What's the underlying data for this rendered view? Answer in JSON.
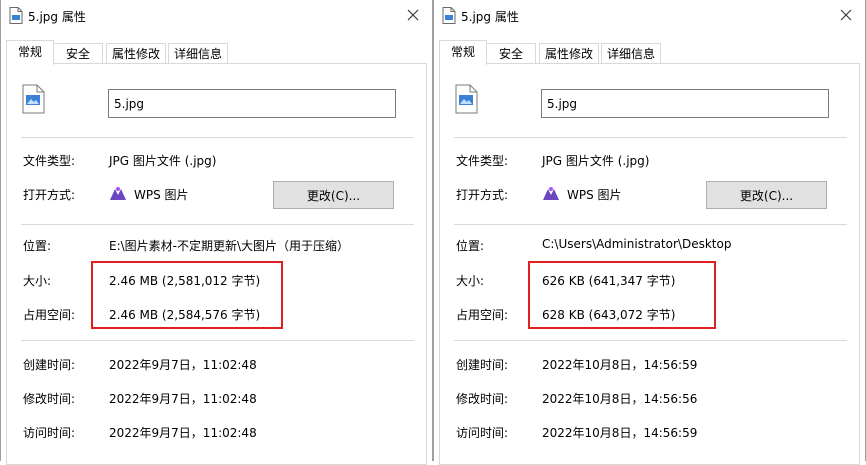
{
  "dialogs": [
    {
      "title": "5.jpg 属性",
      "tabs": [
        "常规",
        "安全",
        "属性修改",
        "详细信息"
      ],
      "filename": "5.jpg",
      "labels": {
        "type": "文件类型:",
        "open_with": "打开方式:",
        "location": "位置:",
        "size": "大小:",
        "size_on_disk": "占用空间:",
        "created": "创建时间:",
        "modified": "修改时间:",
        "accessed": "访问时间:"
      },
      "file_type": "JPG 图片文件 (.jpg)",
      "open_with_app": "WPS 图片",
      "change_button": "更改(C)...",
      "location": "E:\\图片素材-不定期更新\\大图片（用于压缩）",
      "size": "2.46 MB (2,581,012 字节)",
      "size_on_disk": "2.46 MB (2,584,576 字节)",
      "created": "2022年9月7日，11:02:48",
      "modified": "2022年9月7日，11:02:48",
      "accessed": "2022年9月7日，11:02:48"
    },
    {
      "title": "5.jpg 属性",
      "tabs": [
        "常规",
        "安全",
        "属性修改",
        "详细信息"
      ],
      "filename": "5.jpg",
      "labels": {
        "type": "文件类型:",
        "open_with": "打开方式:",
        "location": "位置:",
        "size": "大小:",
        "size_on_disk": "占用空间:",
        "created": "创建时间:",
        "modified": "修改时间:",
        "accessed": "访问时间:"
      },
      "file_type": "JPG 图片文件 (.jpg)",
      "open_with_app": "WPS 图片",
      "change_button": "更改(C)...",
      "location": "C:\\Users\\Administrator\\Desktop",
      "size": "626 KB (641,347 字节)",
      "size_on_disk": "628 KB (643,072 字节)",
      "created": "2022年10月8日，14:56:59",
      "modified": "2022年10月8日，14:56:56",
      "accessed": "2022年10月8日，14:56:59"
    }
  ],
  "colors": {
    "highlight_border": "#e02020",
    "file_icon_accent": "#3b82d6",
    "wps_icon": "#6b46c1"
  },
  "icons": {
    "title": "document-icon",
    "file": "image-file-icon",
    "app": "wps-pictures-icon",
    "close": "close-icon"
  }
}
